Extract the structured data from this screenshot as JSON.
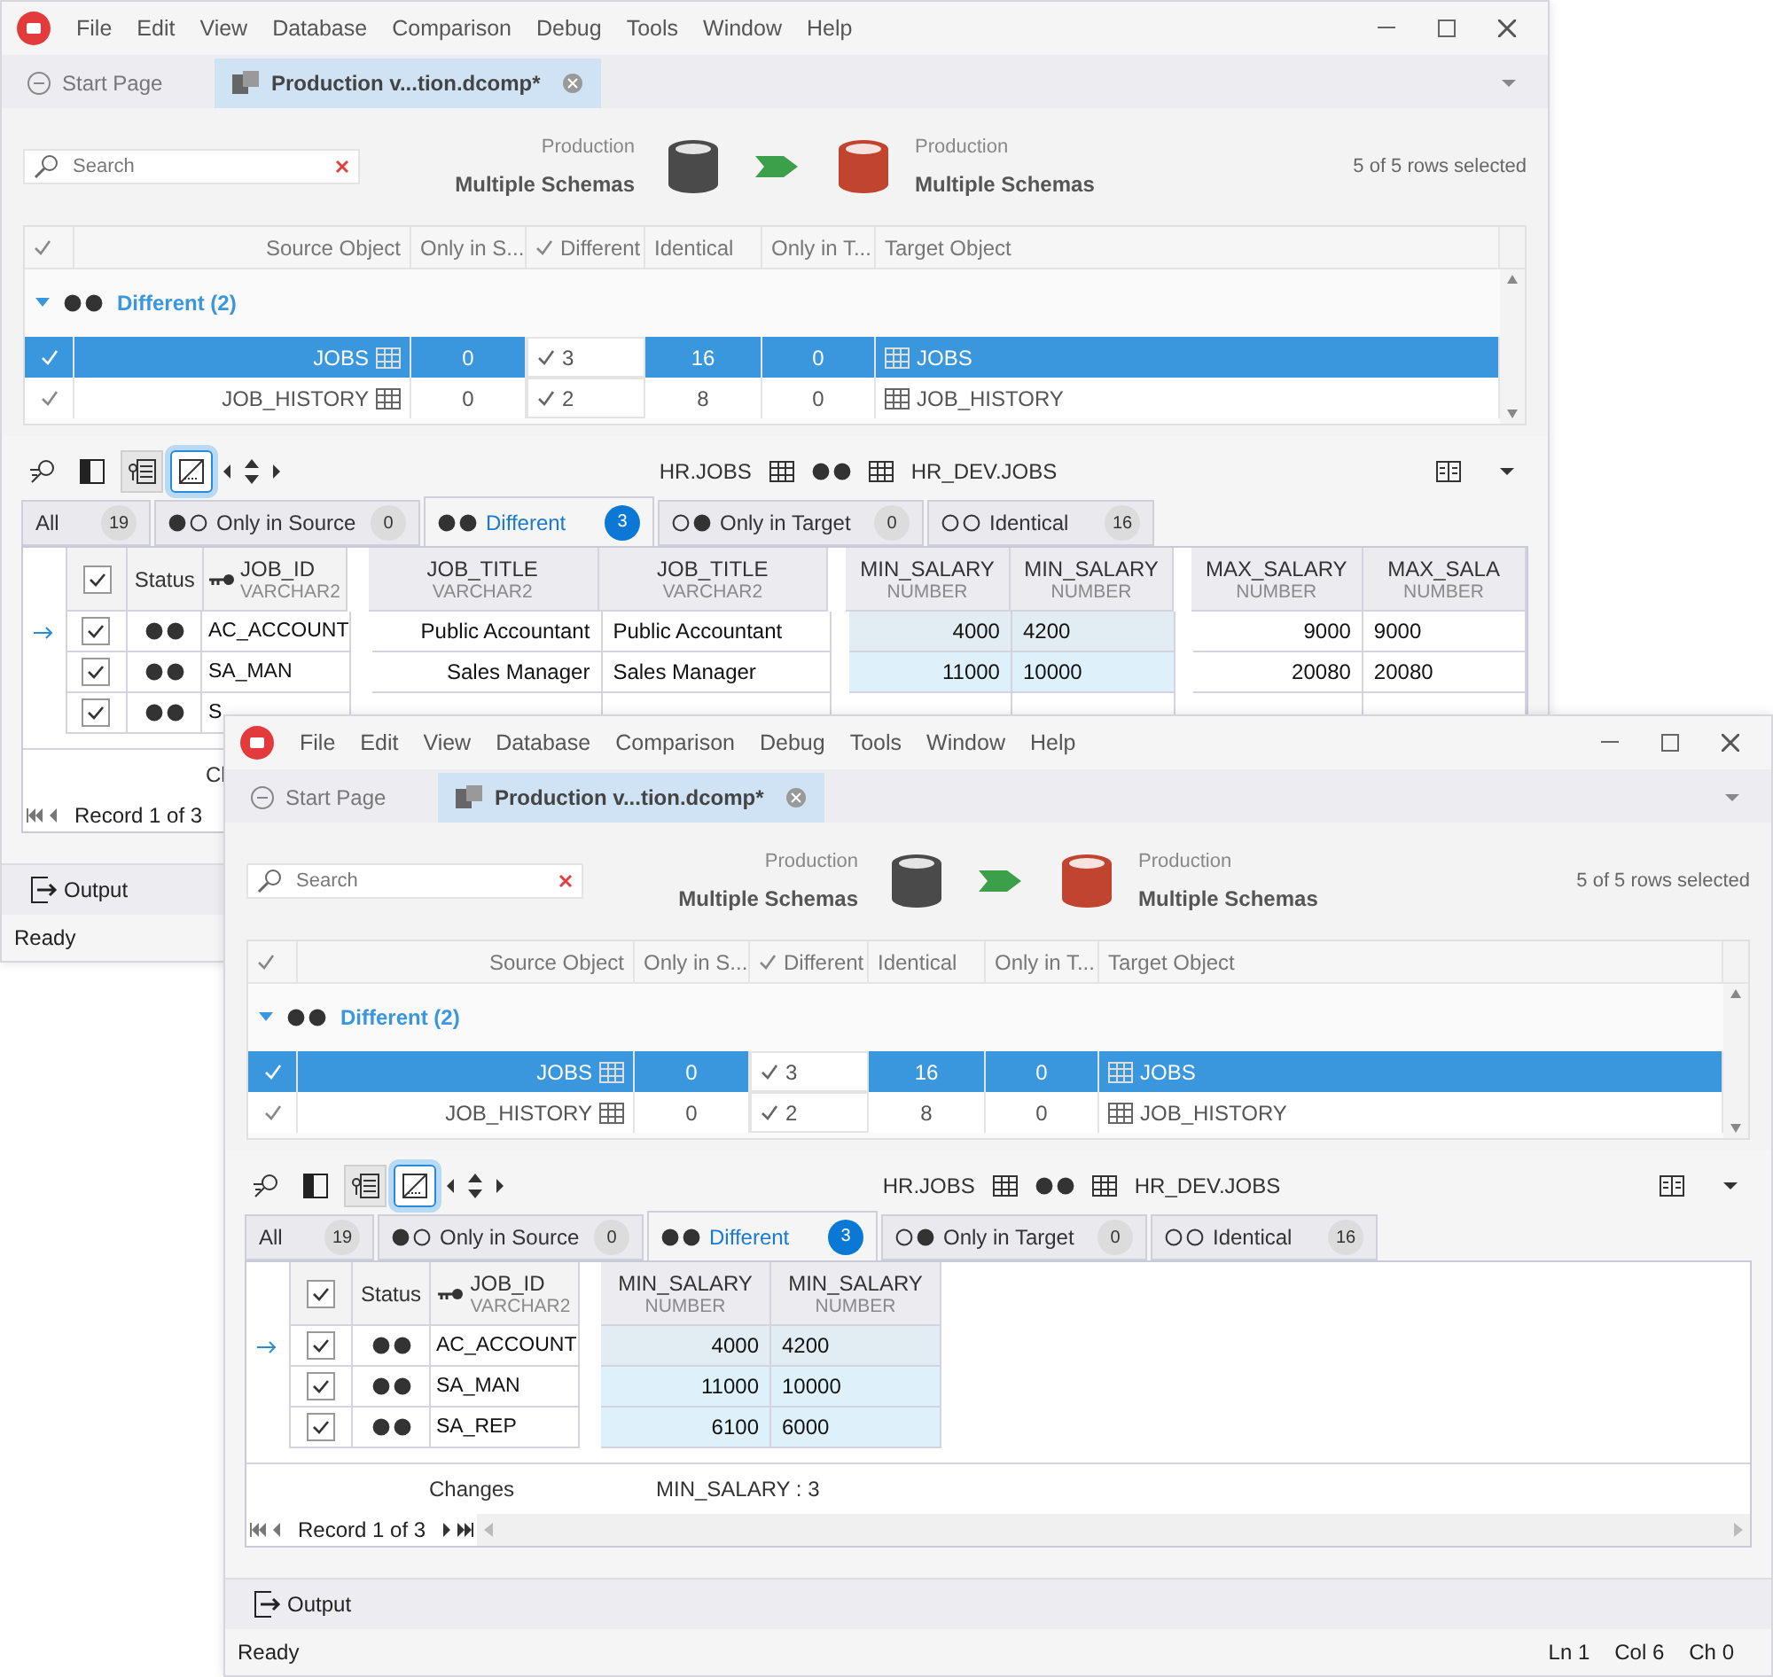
{
  "windows": [
    {
      "menu": [
        "File",
        "Edit",
        "View",
        "Database",
        "Comparison",
        "Debug",
        "Tools",
        "Window",
        "Help"
      ],
      "doc_tabs": [
        {
          "label": "Start Page",
          "kind": "start",
          "selected": false
        },
        {
          "label": "Production v...tion.dcomp*",
          "kind": "comparison",
          "selected": true
        }
      ],
      "search": {
        "placeholder": "Search"
      },
      "source": {
        "label": "Production",
        "schema": "Multiple Schemas"
      },
      "target": {
        "label": "Production",
        "schema": "Multiple Schemas"
      },
      "selection": "5 of 5 rows selected",
      "object_grid": {
        "columns": [
          {
            "kind": "check",
            "checked": true
          },
          {
            "kind": "text",
            "label": "Source Object"
          },
          {
            "kind": "text",
            "label": "Only in S..."
          },
          {
            "kind": "check_text",
            "label": "Different",
            "checked": true
          },
          {
            "kind": "text",
            "label": "Identical"
          },
          {
            "kind": "text",
            "label": "Only in T..."
          },
          {
            "kind": "text",
            "label": "Target Object"
          }
        ],
        "group": {
          "label": "Different (2)",
          "kind": "different",
          "expanded": true
        },
        "rows": [
          {
            "checked": true,
            "selected": true,
            "source": "JOBS",
            "only_in_source": "0",
            "different": "3",
            "identical": "16",
            "only_in_target": "0",
            "target": "JOBS"
          },
          {
            "checked": true,
            "selected": false,
            "source": "JOB_HISTORY",
            "only_in_source": "0",
            "different": "2",
            "identical": "8",
            "only_in_target": "0",
            "target": "JOB_HISTORY"
          }
        ]
      },
      "toolbar": {
        "tools": [
          {
            "kind": "filter",
            "on": false,
            "focused": false
          },
          {
            "kind": "columns",
            "on": false,
            "focused": false
          },
          {
            "kind": "tree",
            "on": true,
            "focused": false
          },
          {
            "kind": "diagonal",
            "on": true,
            "focused": true
          }
        ],
        "source": "HR.JOBS",
        "target": "HR_DEV.JOBS"
      },
      "filter_tabs": [
        {
          "label": "All",
          "kind": "all",
          "count": "19",
          "selected": false
        },
        {
          "label": "Only in Source",
          "kind": "source",
          "count": "0",
          "selected": false
        },
        {
          "label": "Different",
          "kind": "different",
          "count": "3",
          "selected": true
        },
        {
          "label": "Only in Target",
          "kind": "target",
          "count": "0",
          "selected": false
        },
        {
          "label": "Identical",
          "kind": "identical",
          "count": "16",
          "selected": false
        }
      ],
      "data_grid": {
        "header": {
          "checked": true,
          "status": "Status",
          "key": "JOB_ID",
          "key_type": "VARCHAR2"
        },
        "groups": [
          {
            "kind": "text",
            "changed": false,
            "columns": [
              {
                "name": "JOB_TITLE",
                "type": "VARCHAR2"
              },
              {
                "name": "JOB_TITLE",
                "type": "VARCHAR2"
              }
            ]
          },
          {
            "kind": "number",
            "changed": true,
            "columns": [
              {
                "name": "MIN_SALARY",
                "type": "NUMBER"
              },
              {
                "name": "MIN_SALARY",
                "type": "NUMBER"
              }
            ]
          },
          {
            "kind": "number",
            "changed": false,
            "columns": [
              {
                "name": "MAX_SALARY",
                "type": "NUMBER"
              },
              {
                "name": "MAX_SALA",
                "type": "NUMBER"
              }
            ]
          }
        ],
        "rows": [
          {
            "checked": true,
            "current": true,
            "kind": "different",
            "key": "AC_ACCOUNT",
            "values": [
              [
                "Public Accountant",
                "Public Accountant"
              ],
              [
                "4000",
                "4200"
              ],
              [
                "9000",
                "9000"
              ]
            ]
          },
          {
            "checked": true,
            "current": false,
            "kind": "different",
            "key": "SA_MAN",
            "values": [
              [
                "Sales Manager",
                "Sales Manager"
              ],
              [
                "11000",
                "10000"
              ],
              [
                "20080",
                "20080"
              ]
            ]
          },
          {
            "checked": true,
            "current": false,
            "kind": "different",
            "key": "S",
            "values": []
          }
        ],
        "footer": {
          "label": "Cl"
        },
        "pager": {
          "label": "Record 1 of 3",
          "show_next": false
        }
      },
      "output": "Output",
      "status_bar": {
        "text": "Ready"
      }
    },
    {
      "menu": [
        "File",
        "Edit",
        "View",
        "Database",
        "Comparison",
        "Debug",
        "Tools",
        "Window",
        "Help"
      ],
      "doc_tabs": [
        {
          "label": "Start Page",
          "kind": "start",
          "selected": false
        },
        {
          "label": "Production v...tion.dcomp*",
          "kind": "comparison",
          "selected": true
        }
      ],
      "search": {
        "placeholder": "Search"
      },
      "source": {
        "label": "Production",
        "schema": "Multiple Schemas"
      },
      "target": {
        "label": "Production",
        "schema": "Multiple Schemas"
      },
      "selection": "5 of 5 rows selected",
      "object_grid": {
        "columns": [
          {
            "kind": "check",
            "checked": true
          },
          {
            "kind": "text",
            "label": "Source Object"
          },
          {
            "kind": "text",
            "label": "Only in S..."
          },
          {
            "kind": "check_text",
            "label": "Different",
            "checked": true
          },
          {
            "kind": "text",
            "label": "Identical"
          },
          {
            "kind": "text",
            "label": "Only in T..."
          },
          {
            "kind": "text",
            "label": "Target Object"
          }
        ],
        "group": {
          "label": "Different (2)",
          "kind": "different",
          "expanded": true
        },
        "rows": [
          {
            "checked": true,
            "selected": true,
            "source": "JOBS",
            "only_in_source": "0",
            "different": "3",
            "identical": "16",
            "only_in_target": "0",
            "target": "JOBS"
          },
          {
            "checked": true,
            "selected": false,
            "source": "JOB_HISTORY",
            "only_in_source": "0",
            "different": "2",
            "identical": "8",
            "only_in_target": "0",
            "target": "JOB_HISTORY"
          }
        ]
      },
      "toolbar": {
        "tools": [
          {
            "kind": "filter",
            "on": false,
            "focused": false
          },
          {
            "kind": "columns",
            "on": false,
            "focused": false
          },
          {
            "kind": "tree",
            "on": true,
            "focused": false
          },
          {
            "kind": "diagonal",
            "on": true,
            "focused": true
          }
        ],
        "source": "HR.JOBS",
        "target": "HR_DEV.JOBS"
      },
      "filter_tabs": [
        {
          "label": "All",
          "kind": "all",
          "count": "19",
          "selected": false
        },
        {
          "label": "Only in Source",
          "kind": "source",
          "count": "0",
          "selected": false
        },
        {
          "label": "Different",
          "kind": "different",
          "count": "3",
          "selected": true
        },
        {
          "label": "Only in Target",
          "kind": "target",
          "count": "0",
          "selected": false
        },
        {
          "label": "Identical",
          "kind": "identical",
          "count": "16",
          "selected": false
        }
      ],
      "data_grid": {
        "header": {
          "checked": true,
          "status": "Status",
          "key": "JOB_ID",
          "key_type": "VARCHAR2"
        },
        "groups": [
          {
            "kind": "number",
            "changed": true,
            "columns": [
              {
                "name": "MIN_SALARY",
                "type": "NUMBER"
              },
              {
                "name": "MIN_SALARY",
                "type": "NUMBER"
              }
            ]
          }
        ],
        "rows": [
          {
            "checked": true,
            "current": true,
            "kind": "different",
            "key": "AC_ACCOUNT",
            "values": [
              [
                "4000",
                "4200"
              ]
            ]
          },
          {
            "checked": true,
            "current": false,
            "kind": "different",
            "key": "SA_MAN",
            "values": [
              [
                "11000",
                "10000"
              ]
            ]
          },
          {
            "checked": true,
            "current": false,
            "kind": "different",
            "key": "SA_REP",
            "values": [
              [
                "6100",
                "6000"
              ]
            ]
          }
        ],
        "footer": {
          "label": "Changes",
          "value": "MIN_SALARY : 3"
        },
        "pager": {
          "label": "Record 1 of 3",
          "show_next": true
        }
      },
      "output": "Output",
      "status_bar": {
        "text": "Ready",
        "position": [
          "Ln 1",
          "Col 6",
          "Ch 0"
        ]
      }
    }
  ]
}
